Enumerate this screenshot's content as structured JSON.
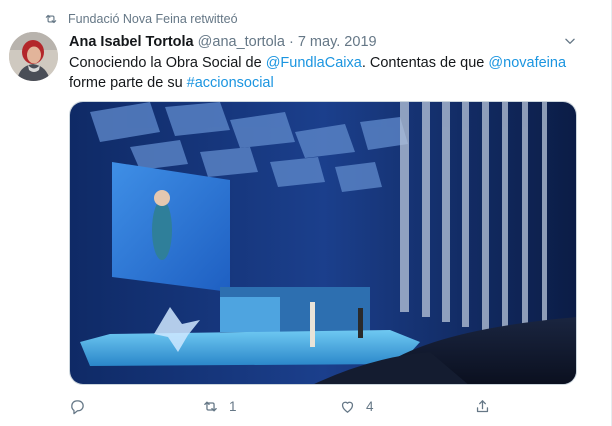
{
  "retweet": {
    "text": "Fundació Nova Feina retwitteó",
    "icon": "retweet-icon"
  },
  "tweet": {
    "author_name": "Ana Isabel Tortola",
    "handle": "@ana_tortola",
    "separator": "·",
    "date": "7 may. 2019",
    "text_parts": {
      "p1": "Conociendo la Obra Social de ",
      "mention1": "@FundlaCaixa",
      "p2": ". Contentas de que ",
      "mention2": "@novafeina",
      "p3": " forme parte de su ",
      "hashtag": "#accionsocial"
    }
  },
  "actions": {
    "reply_count": "",
    "retweet_count": "1",
    "like_count": "4"
  },
  "colors": {
    "link": "#1b95e0",
    "muted": "#657786",
    "text": "#14171a"
  }
}
